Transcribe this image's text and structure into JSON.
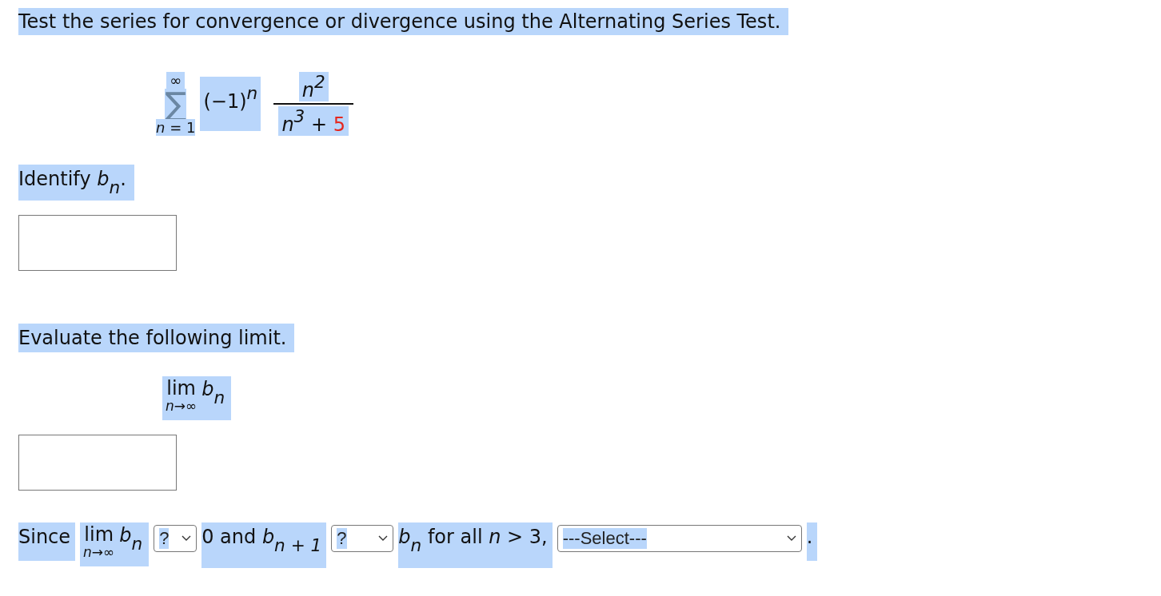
{
  "question": "Test the series for convergence or divergence using the Alternating Series Test.",
  "series": {
    "upper": "∞",
    "sigma": "∑",
    "lower": "*n* = 1",
    "factor": "(−1)$^{n}$",
    "numerator": "*n*$^{2}$",
    "denominator": "*n*$^{3}$ + ",
    "constant": "5"
  },
  "steps": [
    {
      "prompt": "Identify *b*$_{n}$.",
      "answer": {
        "kind": "blank"
      }
    },
    {
      "prompt": "Evaluate the following limit.",
      "limit": {
        "op": "lim",
        "under": "n→∞",
        "body": "*b*$_{n}$"
      },
      "answer": {
        "kind": "blank"
      }
    }
  ],
  "conclusion": [
    {
      "kind": "text",
      "text": "Since"
    },
    {
      "kind": "limit",
      "op": "lim",
      "under": "n→∞",
      "body": "*b*$_{n}$"
    },
    {
      "kind": "select",
      "value": "?"
    },
    {
      "kind": "text",
      "text": "0 and *b*$_{n + 1}$"
    },
    {
      "kind": "select",
      "value": "?"
    },
    {
      "kind": "text",
      "text": "*b*$_{n}$ for all *n* > 3,"
    },
    {
      "kind": "select",
      "value": "---Select---"
    },
    {
      "kind": "text",
      "text": "."
    }
  ]
}
